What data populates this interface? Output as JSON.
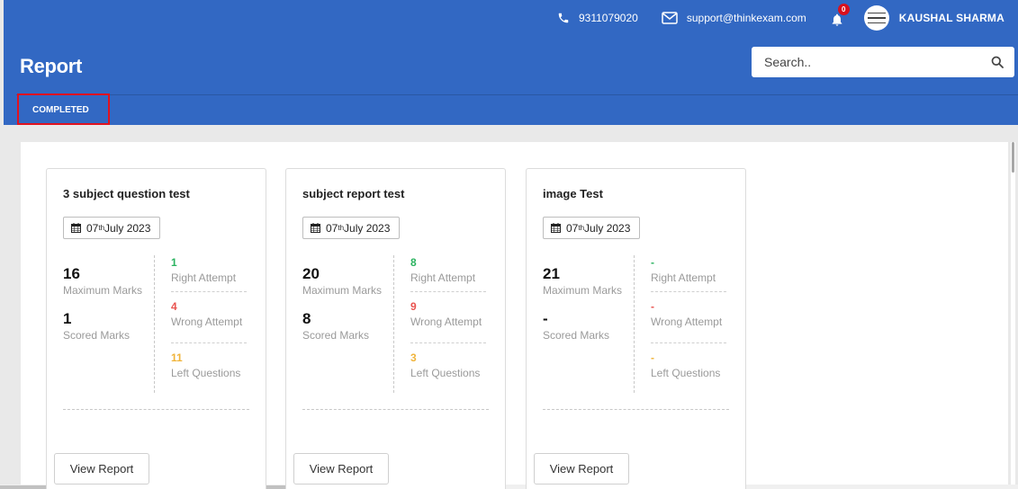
{
  "header": {
    "phone": "9311079020",
    "email": "support@thinkexam.com",
    "notification_count": "0",
    "user_name": "KAUSHAL SHARMA",
    "page_title": "Report",
    "search_placeholder": "Search..",
    "tabs": [
      {
        "label": "COMPLETED",
        "active": true
      }
    ]
  },
  "colors": {
    "header_bg": "#3268c3",
    "right": "#2bb360",
    "wrong": "#e9534f",
    "left": "#f0b43b",
    "tab_highlight": "#e0121f"
  },
  "cards": [
    {
      "title": "3 subject question test",
      "date_day": "07",
      "date_suffix": "th",
      "date_rest": " July 2023",
      "max_marks": "16",
      "max_marks_label": "Maximum Marks",
      "scored_marks": "1",
      "scored_marks_label": "Scored Marks",
      "right_attempt": "1",
      "right_attempt_label": "Right Attempt",
      "wrong_attempt": "4",
      "wrong_attempt_label": "Wrong Attempt",
      "left_questions": "11",
      "left_questions_label": "Left Questions",
      "button": "View Report"
    },
    {
      "title": "subject report test",
      "date_day": "07",
      "date_suffix": "th",
      "date_rest": " July 2023",
      "max_marks": "20",
      "max_marks_label": "Maximum Marks",
      "scored_marks": "8",
      "scored_marks_label": "Scored Marks",
      "right_attempt": "8",
      "right_attempt_label": "Right Attempt",
      "wrong_attempt": "9",
      "wrong_attempt_label": "Wrong Attempt",
      "left_questions": "3",
      "left_questions_label": "Left Questions",
      "button": "View Report"
    },
    {
      "title": "image Test",
      "date_day": "07",
      "date_suffix": "th",
      "date_rest": " July 2023",
      "max_marks": "21",
      "max_marks_label": "Maximum Marks",
      "scored_marks": "-",
      "scored_marks_label": "Scored Marks",
      "right_attempt": "-",
      "right_attempt_label": "Right Attempt",
      "wrong_attempt": "-",
      "wrong_attempt_label": "Wrong Attempt",
      "left_questions": "-",
      "left_questions_label": "Left Questions",
      "button": "View Report"
    }
  ],
  "icons": [
    "phone-icon",
    "email-icon",
    "bell-icon",
    "search-icon",
    "calendar-icon"
  ]
}
